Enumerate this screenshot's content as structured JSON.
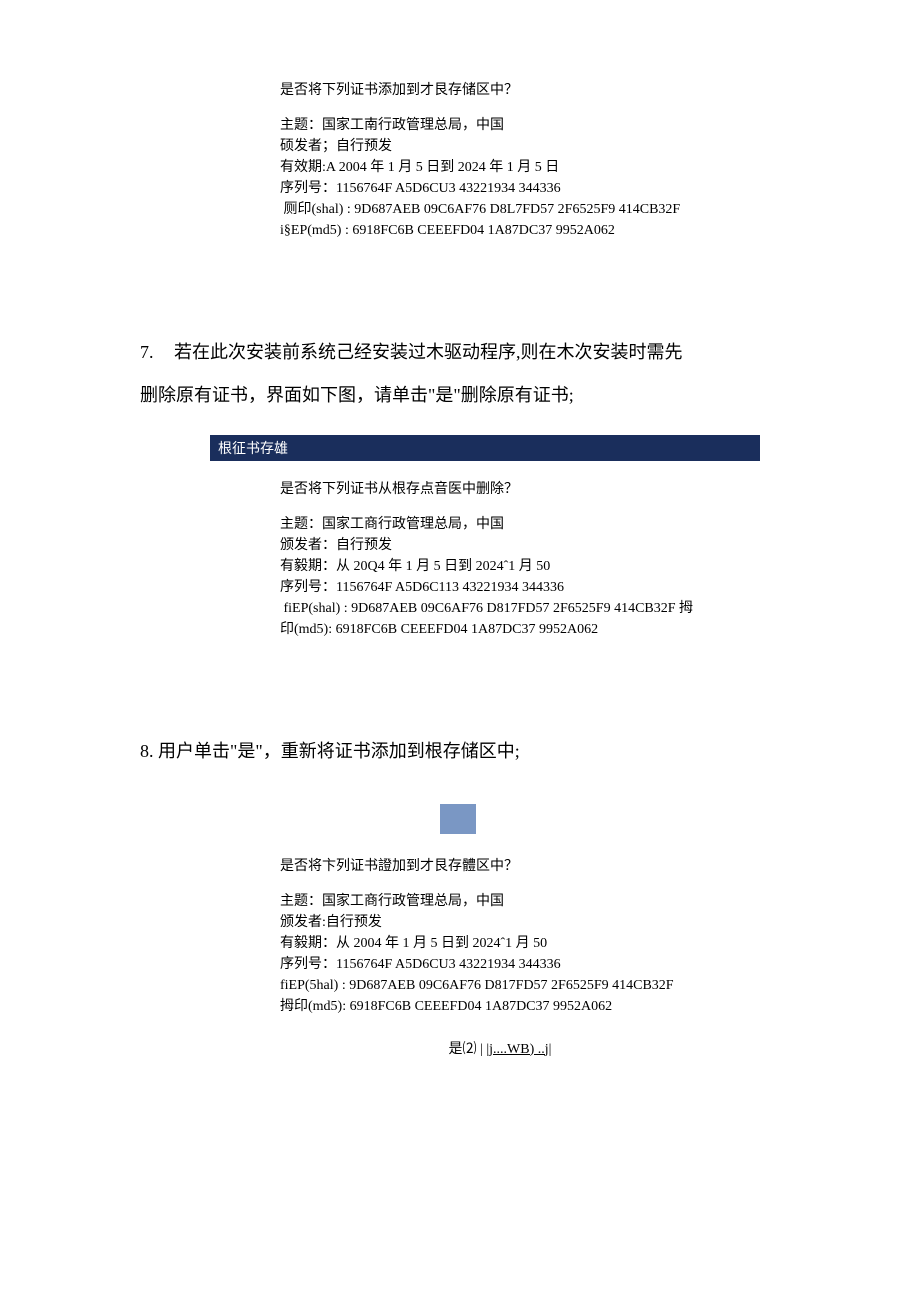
{
  "dialog1": {
    "q": "是否将下列证书添加到才艮存储区中？",
    "subject": "主题：国家工南行政管理总局，中国",
    "issuer": "硕发者；自行预发",
    "validity": "有效期:A 2004 年 1 月 5 日到 2024 年 1 月 5 日",
    "serial": "序列号：1156764F A5D6CU3 43221934 344336",
    "sha1": " 厕印(shal) : 9D687AEB 09C6AF76 D8L7FD57 2F6525F9 414CB32F",
    "md5": "i§EP(md5) : 6918FC6B CEEEFD04 1A87DC37 9952A062"
  },
  "step7": {
    "num": "7.",
    "line1": "若在此次安装前系统己经安装过木驱动程序,则在木次安装时需先",
    "line2": "删除原有证书，界面如下图，请单击\"是\"删除原有证书;"
  },
  "titlebar2": "根征书存雄",
  "dialog2": {
    "q": "是否将下列证书从根存点音医中删除？",
    "subject": "主题：国家工商行政管理总局，中国",
    "issuer": "颁发者：自行预发",
    "validity": "有毅期：从 20Q4 年 1 月 5 日到 2024ˆ1 月 50",
    "serial": "序列号：1156764F A5D6C113 43221934 344336",
    "sha1": " fiEP(shal) : 9D687AEB 09C6AF76 D817FD57 2F6525F9 414CB32F 拇",
    "md5": "印(md5): 6918FC6B CEEEFD04 1A87DC37 9952A062"
  },
  "step8": {
    "num": "8.",
    "text": "用户单击\"是\"，重新将证书添加到根存储区中;"
  },
  "dialog3": {
    "q": "是否将卞列证书證加到才艮存體区中？",
    "subject": "主题：国家工商行政管理总局，中国",
    "issuer": "颁发者:自行预发",
    "validity": "有毅期：从 2004 年 1 月 5 日到 2024ˆ1 月 50",
    "serial": "序列号：1156764F A5D6CU3 43221934 344336",
    "sha1": "fiEP(5hal) : 9D687AEB 09C6AF76 D817FD57 2F6525F9 414CB32F",
    "md5": "拇印(md5): 6918FC6B CEEEFD04 1A87DC37 9952A062",
    "btn_yes": "是⑵ | ",
    "btn_no": "|j....WB) ..j|"
  }
}
